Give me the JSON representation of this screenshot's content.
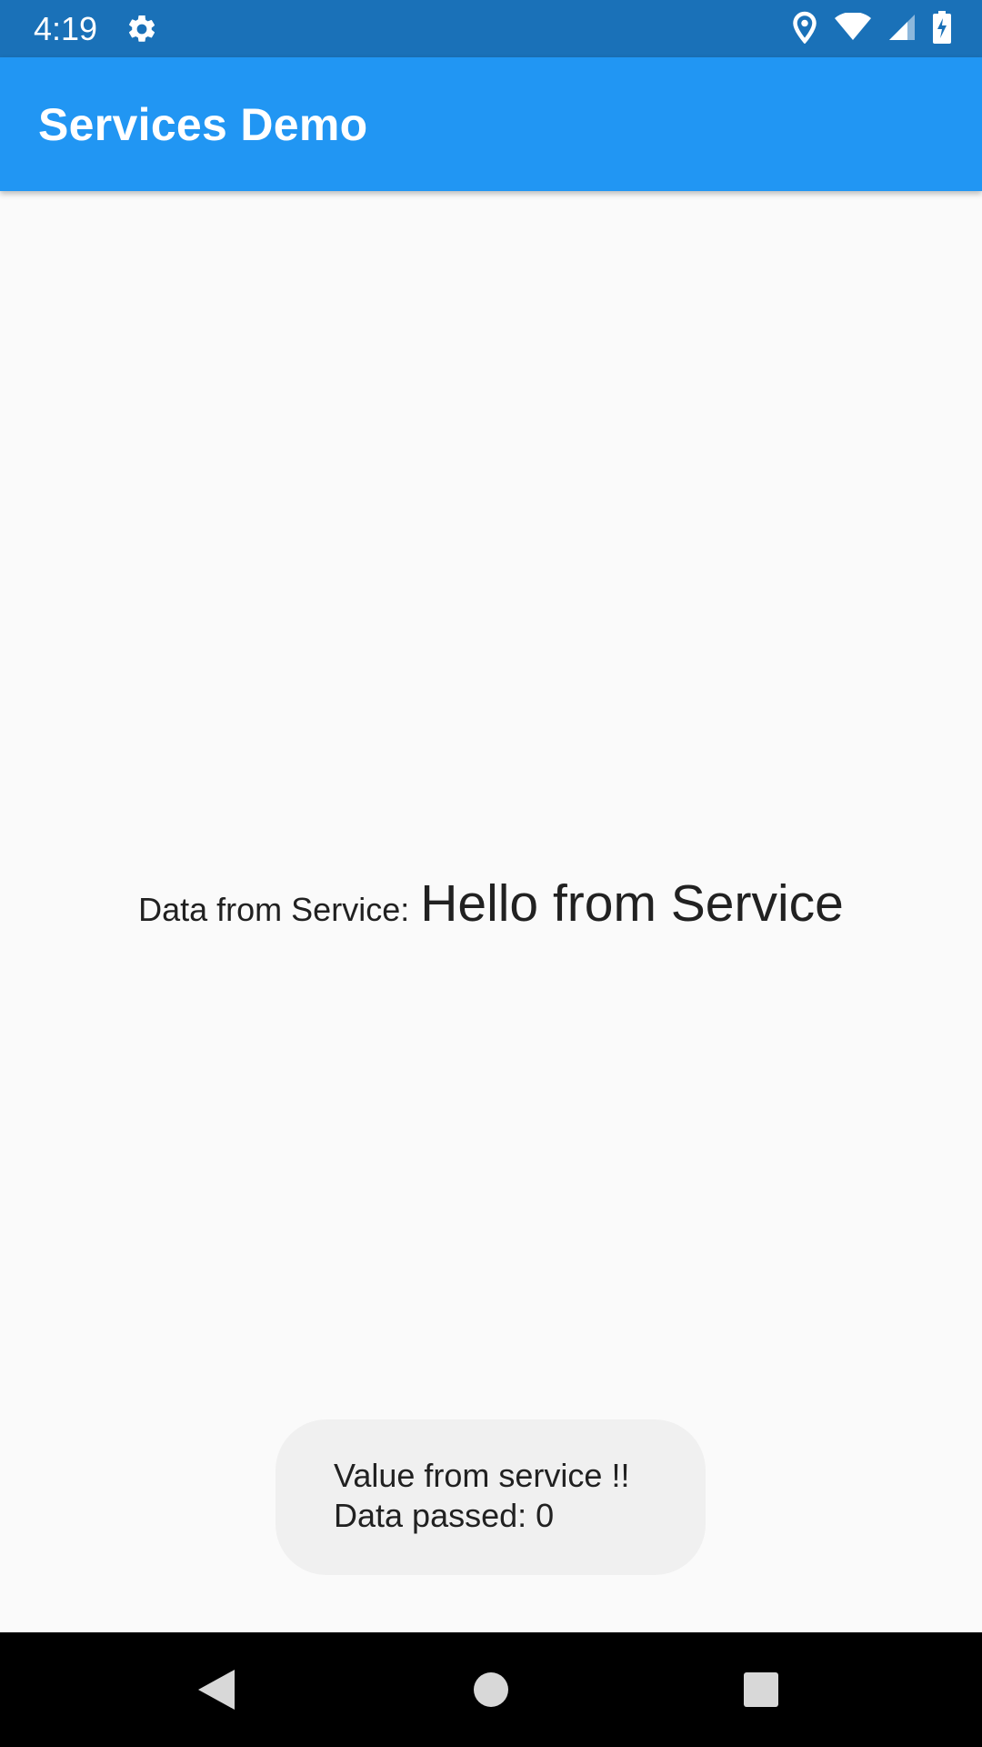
{
  "status_bar": {
    "time": "4:19",
    "icons": [
      "settings-icon",
      "location-icon",
      "wifi-icon",
      "signal-icon",
      "battery-charging-icon"
    ]
  },
  "app_bar": {
    "title": "Services Demo",
    "color": "#2196f3"
  },
  "main": {
    "label": "Data from Service:",
    "value": "Hello from Service"
  },
  "toast": {
    "line1": "Value from service !!",
    "line2": "Data passed: 0"
  },
  "nav_bar": {
    "buttons": [
      "back-icon",
      "home-icon",
      "recents-icon"
    ]
  }
}
